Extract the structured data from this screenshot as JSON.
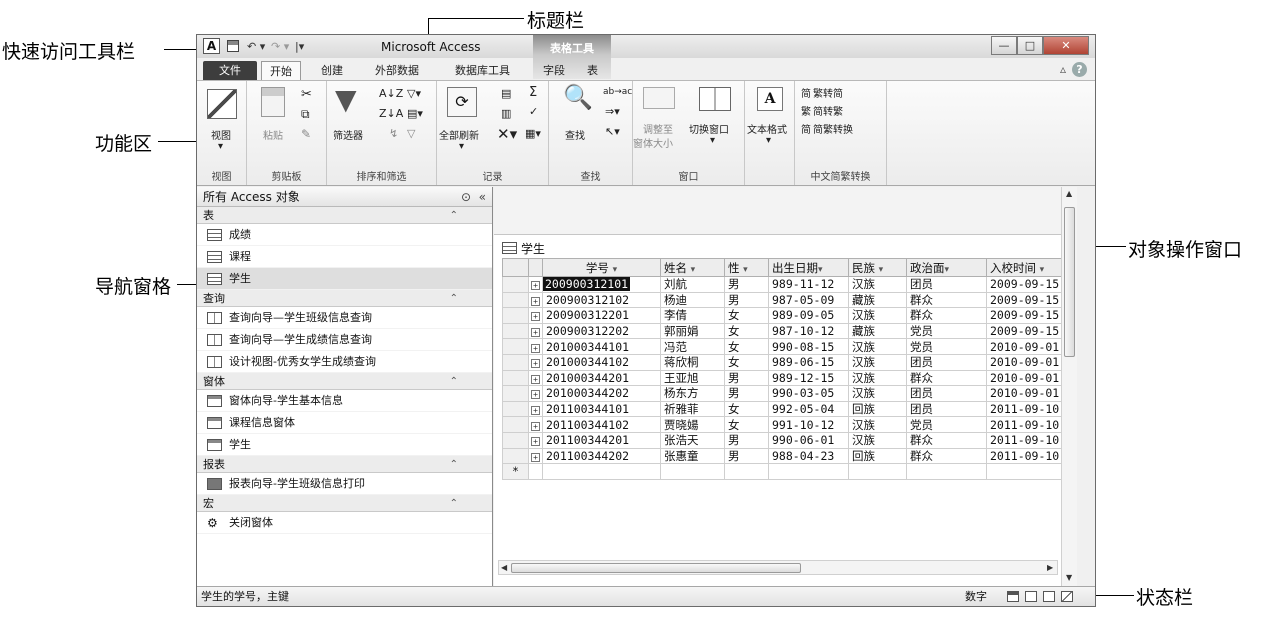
{
  "callouts": {
    "title_bar": "标题栏",
    "quick_access": "快速访问工具栏",
    "ribbon": "功能区",
    "nav_pane": "导航窗格",
    "object_window": "对象操作窗口",
    "status_bar": "状态栏"
  },
  "window": {
    "app_title": "Microsoft Access",
    "context_tab": "表格工具"
  },
  "ribbon_tabs": [
    "文件",
    "开始",
    "创建",
    "外部数据",
    "数据库工具",
    "字段",
    "表"
  ],
  "ribbon": {
    "view": {
      "button": "视图",
      "group": "视图"
    },
    "clipboard": {
      "paste": "粘贴",
      "group": "剪贴板"
    },
    "sort_filter": {
      "filter": "筛选器",
      "group": "排序和筛选"
    },
    "records": {
      "refresh": "全部刷新",
      "group": "记录"
    },
    "find": {
      "button": "查找",
      "group": "查找"
    },
    "window": {
      "fit_1": "调整至",
      "fit_2": "窗体大小",
      "switch": "切换窗口",
      "group": "窗口"
    },
    "text_format": {
      "button": "文本格式"
    },
    "chinese": {
      "t2s": "繁转简",
      "s2t": "简转繁",
      "convert": "简繁转换",
      "group": "中文简繁转换"
    }
  },
  "nav": {
    "header": "所有 Access 对象",
    "sections": [
      {
        "title": "表",
        "items": [
          "成绩",
          "课程",
          "学生"
        ]
      },
      {
        "title": "查询",
        "items": [
          "查询向导—学生班级信息查询",
          "查询向导—学生成绩信息查询",
          "设计视图-优秀女学生成绩查询"
        ]
      },
      {
        "title": "窗体",
        "items": [
          "窗体向导-学生基本信息",
          "课程信息窗体",
          "学生"
        ]
      },
      {
        "title": "报表",
        "items": [
          "报表向导-学生班级信息打印"
        ]
      },
      {
        "title": "宏",
        "items": [
          "关闭窗体"
        ]
      }
    ]
  },
  "document": {
    "tab_label": "学生",
    "columns": [
      "学号",
      "姓名",
      "性别",
      "出生日期",
      "民族",
      "政治面貌",
      "入校时间"
    ],
    "column_display": [
      "学号",
      "姓名",
      "性 ",
      "出生日期",
      "民族",
      "政治面",
      "入校时间"
    ],
    "rows": [
      [
        "200900312101",
        "刘航",
        "男",
        "989-11-12",
        "汉族",
        "团员",
        "2009-09-15"
      ],
      [
        "200900312102",
        "杨迪",
        "男",
        "987-05-09",
        "藏族",
        "群众",
        "2009-09-15"
      ],
      [
        "200900312201",
        "李倩",
        "女",
        "989-09-05",
        "汉族",
        "群众",
        "2009-09-15"
      ],
      [
        "200900312202",
        "郭丽娟",
        "女",
        "987-10-12",
        "藏族",
        "党员",
        "2009-09-15"
      ],
      [
        "201000344101",
        "冯范",
        "女",
        "990-08-15",
        "汉族",
        "党员",
        "2010-09-01"
      ],
      [
        "201000344102",
        "蒋欣桐",
        "女",
        "989-06-15",
        "汉族",
        "团员",
        "2010-09-01"
      ],
      [
        "201000344201",
        "王亚旭",
        "男",
        "989-12-15",
        "汉族",
        "群众",
        "2010-09-01"
      ],
      [
        "201000344202",
        "杨东方",
        "男",
        "990-03-05",
        "汉族",
        "团员",
        "2010-09-01"
      ],
      [
        "201100344101",
        "祈雅菲",
        "女",
        "992-05-04",
        "回族",
        "团员",
        "2011-09-10"
      ],
      [
        "201100344102",
        "贾晓婸",
        "女",
        "991-10-12",
        "汉族",
        "党员",
        "2011-09-10"
      ],
      [
        "201100344201",
        "张浩天",
        "男",
        "990-06-01",
        "汉族",
        "群众",
        "2011-09-10"
      ],
      [
        "201100344202",
        "张惠童",
        "男",
        "988-04-23",
        "回族",
        "群众",
        "2011-09-10"
      ]
    ],
    "new_row_marker": "*"
  },
  "status": {
    "text": "学生的学号，主键",
    "mode": "数字"
  }
}
